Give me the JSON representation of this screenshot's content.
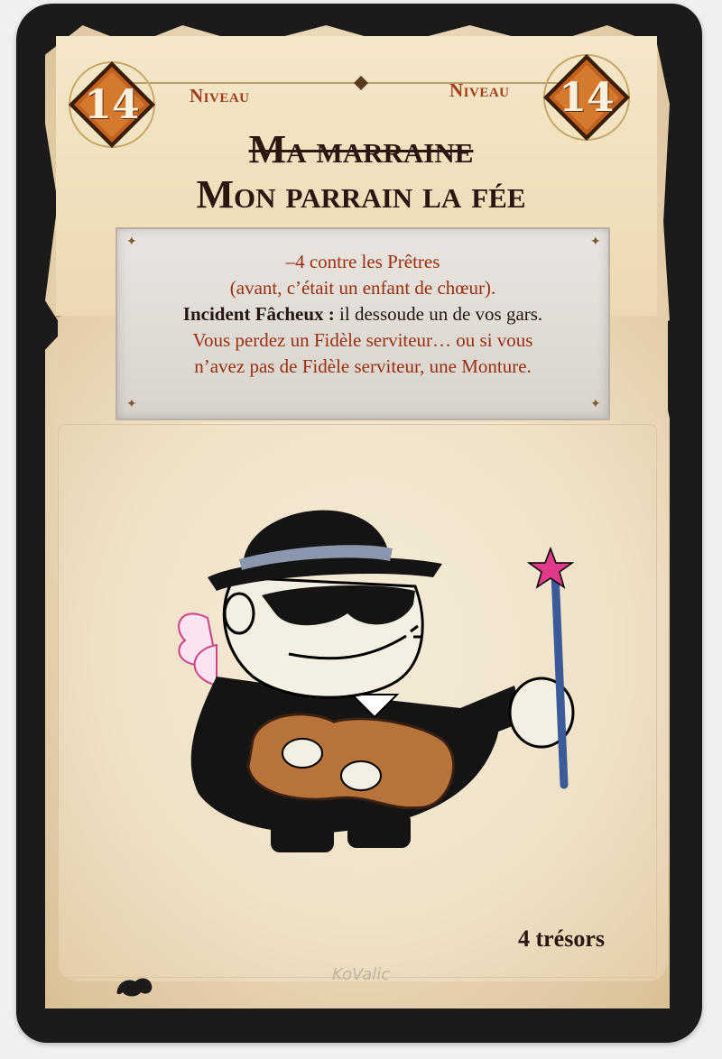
{
  "card": {
    "level_left": "14",
    "level_right": "14",
    "level_label_left": "Niveau",
    "level_label_right": "Niveau",
    "title_struck": "Ma marraine",
    "title_main": "Mon parrain la fée",
    "rules": {
      "line1": "–4 contre les Prêtres",
      "line2": "(avant, c’était un enfant de chœur).",
      "line3_bold": "Incident Fâcheux :",
      "line3_rest": " il dessoude un de vos gars.",
      "line4": "Vous perdez un Fidèle serviteur… ou si vous",
      "line5": "n’avez pas de Fidèle serviteur, une Monture."
    },
    "treasures": "4 trésors",
    "artist_signature": "KoValic"
  },
  "colors": {
    "card_border": "#1d1b1a",
    "parchment": "#ead9b8",
    "accent_red": "#a23b16",
    "level_orange": "#c2611f",
    "title_dark": "#2a1710",
    "rules_box": "#e2ddd7"
  },
  "icons": {
    "level_badge": "diamond-badge-icon",
    "rivet": "rivet-icon",
    "set": "set-symbol-icon",
    "wand_star": "star-icon"
  }
}
